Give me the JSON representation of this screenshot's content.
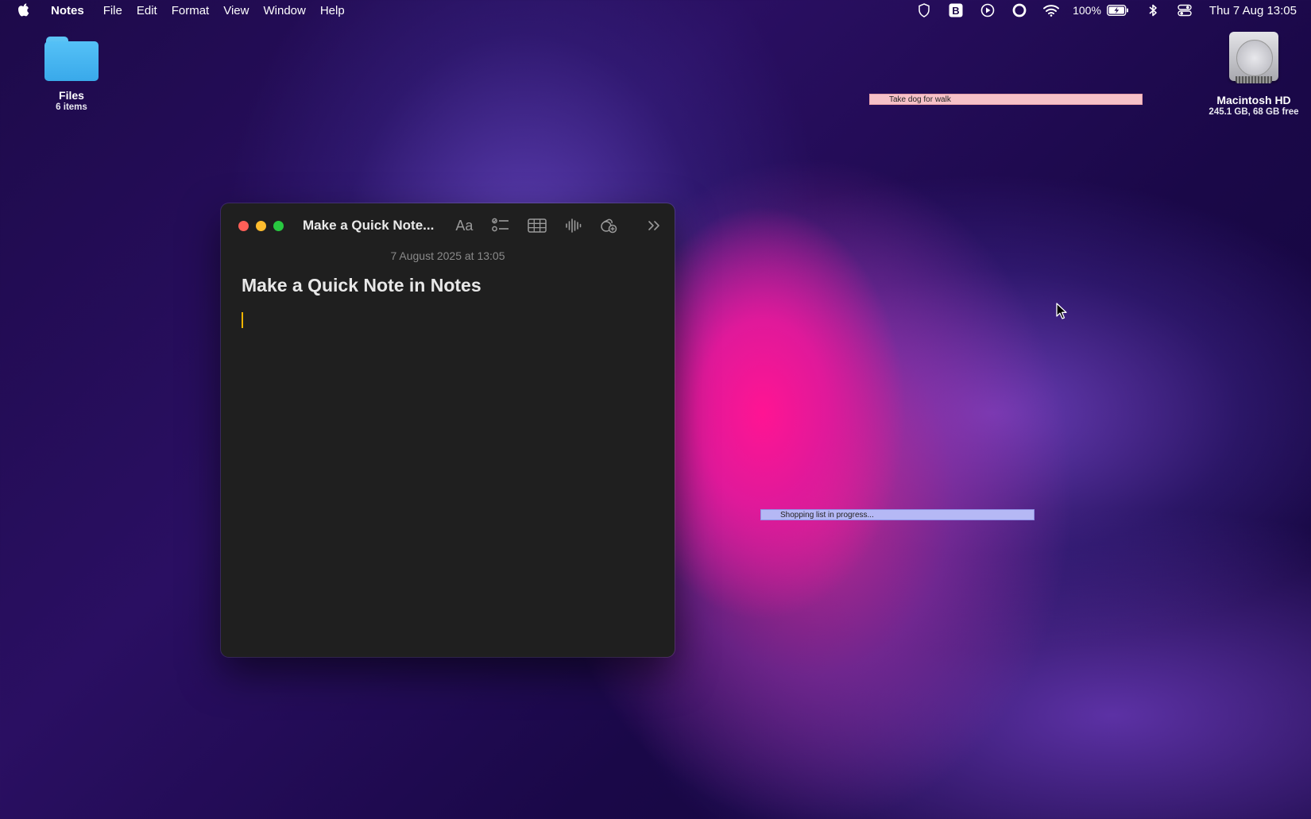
{
  "menubar": {
    "app_name": "Notes",
    "items": [
      "File",
      "Edit",
      "Format",
      "View",
      "Window",
      "Help"
    ],
    "status": {
      "battery": "100%",
      "clock": "Thu 7 Aug  13:05"
    },
    "icons": [
      "apple-icon",
      "shield-icon",
      "b-icon",
      "play-icon",
      "record-icon",
      "wifi-icon",
      "battery-icon",
      "bluetooth-icon",
      "control-center-icon"
    ]
  },
  "desktop": {
    "files_folder": {
      "label": "Files",
      "sub": "6 items"
    },
    "disk": {
      "label": "Macintosh HD",
      "sub": "245.1 GB, 68 GB free"
    }
  },
  "strips": {
    "top": "Take dog for walk",
    "middle": "Shopping list in progress..."
  },
  "note": {
    "window_title": "Make a Quick Note...",
    "format_label": "Aa",
    "date": "7 August 2025 at 13:05",
    "title": "Make a Quick Note in Notes"
  },
  "colors": {
    "close": "#ff5f57",
    "minimize": "#febc2e",
    "zoom": "#28c840",
    "caret": "#f0b400",
    "folder": "#4bb8f2",
    "strip_pink": "#f6c1c8",
    "strip_blue": "#b5b8f5"
  }
}
